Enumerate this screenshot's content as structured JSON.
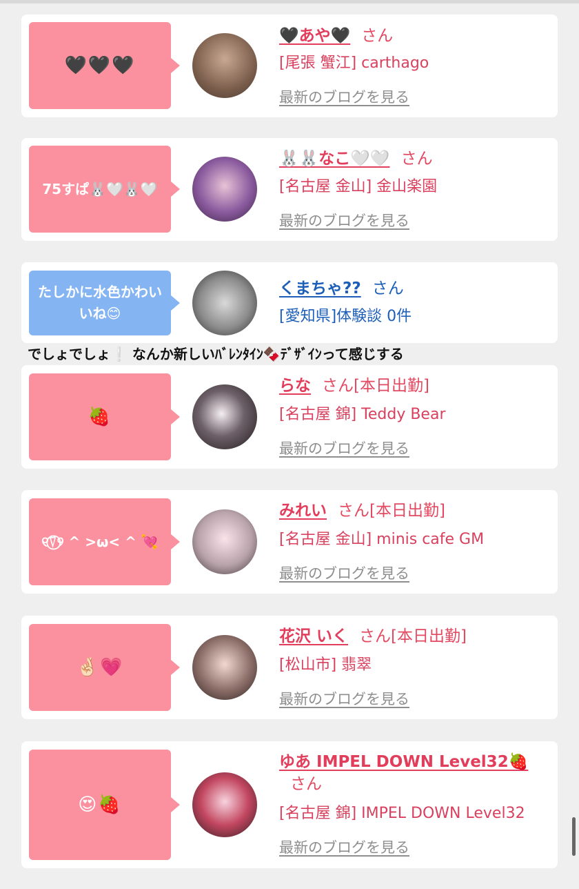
{
  "cards": [
    {
      "bubble_text": "🖤🖤🖤",
      "name": "🖤あや🖤",
      "suffix": "さん",
      "shop": "[尾張 蟹江] carthago",
      "blog_link": "最新のブログを見る"
    },
    {
      "bubble_text": "75すぱ🐰🤍🐰🤍",
      "name": "🐰🐰なこ🤍🤍",
      "suffix": "さん",
      "shop": "[名古屋 金山] 金山楽園",
      "blog_link": "最新のブログを見る"
    },
    {
      "bubble_text": "たしかに水色かわいいね😊",
      "name": "くまちゃ??",
      "suffix": "さん",
      "shop": "[愛知県]体験談 0件"
    },
    {
      "bubble_text": "🍓",
      "name": "らな",
      "suffix": "さん[本日出勤]",
      "shop": "[名古屋 錦] Teddy Bear",
      "blog_link": "最新のブログを見る"
    },
    {
      "bubble_text": "୧⍢⃝୨ ^ >ω< ^ 💘",
      "name": "みれい",
      "suffix": "さん[本日出勤]",
      "shop": "[名古屋 金山] minis cafe GM",
      "blog_link": "最新のブログを見る"
    },
    {
      "bubble_text": "🤞🏻💗",
      "name": "花沢 いく",
      "suffix": "さん[本日出勤]",
      "shop": "[松山市] 翡翠",
      "blog_link": "最新のブログを見る"
    },
    {
      "bubble_text": "😍🍓",
      "name": "ゆあ IMPEL DOWN Level32🍓",
      "suffix": "さん",
      "shop": "[名古屋 錦] IMPEL DOWN Level32",
      "blog_link": "最新のブログを見る"
    }
  ],
  "comment": "でしょでしょ❕ なんか新しいﾊﾞﾚﾝﾀｲﾝ🍫ﾃﾞｻﾞｲﾝって感じする",
  "colors": {
    "pink_bubble": "#fb919f",
    "blue_bubble": "#84b4f2",
    "name_pink": "#e23d5b",
    "name_blue": "#1d5fb8"
  }
}
